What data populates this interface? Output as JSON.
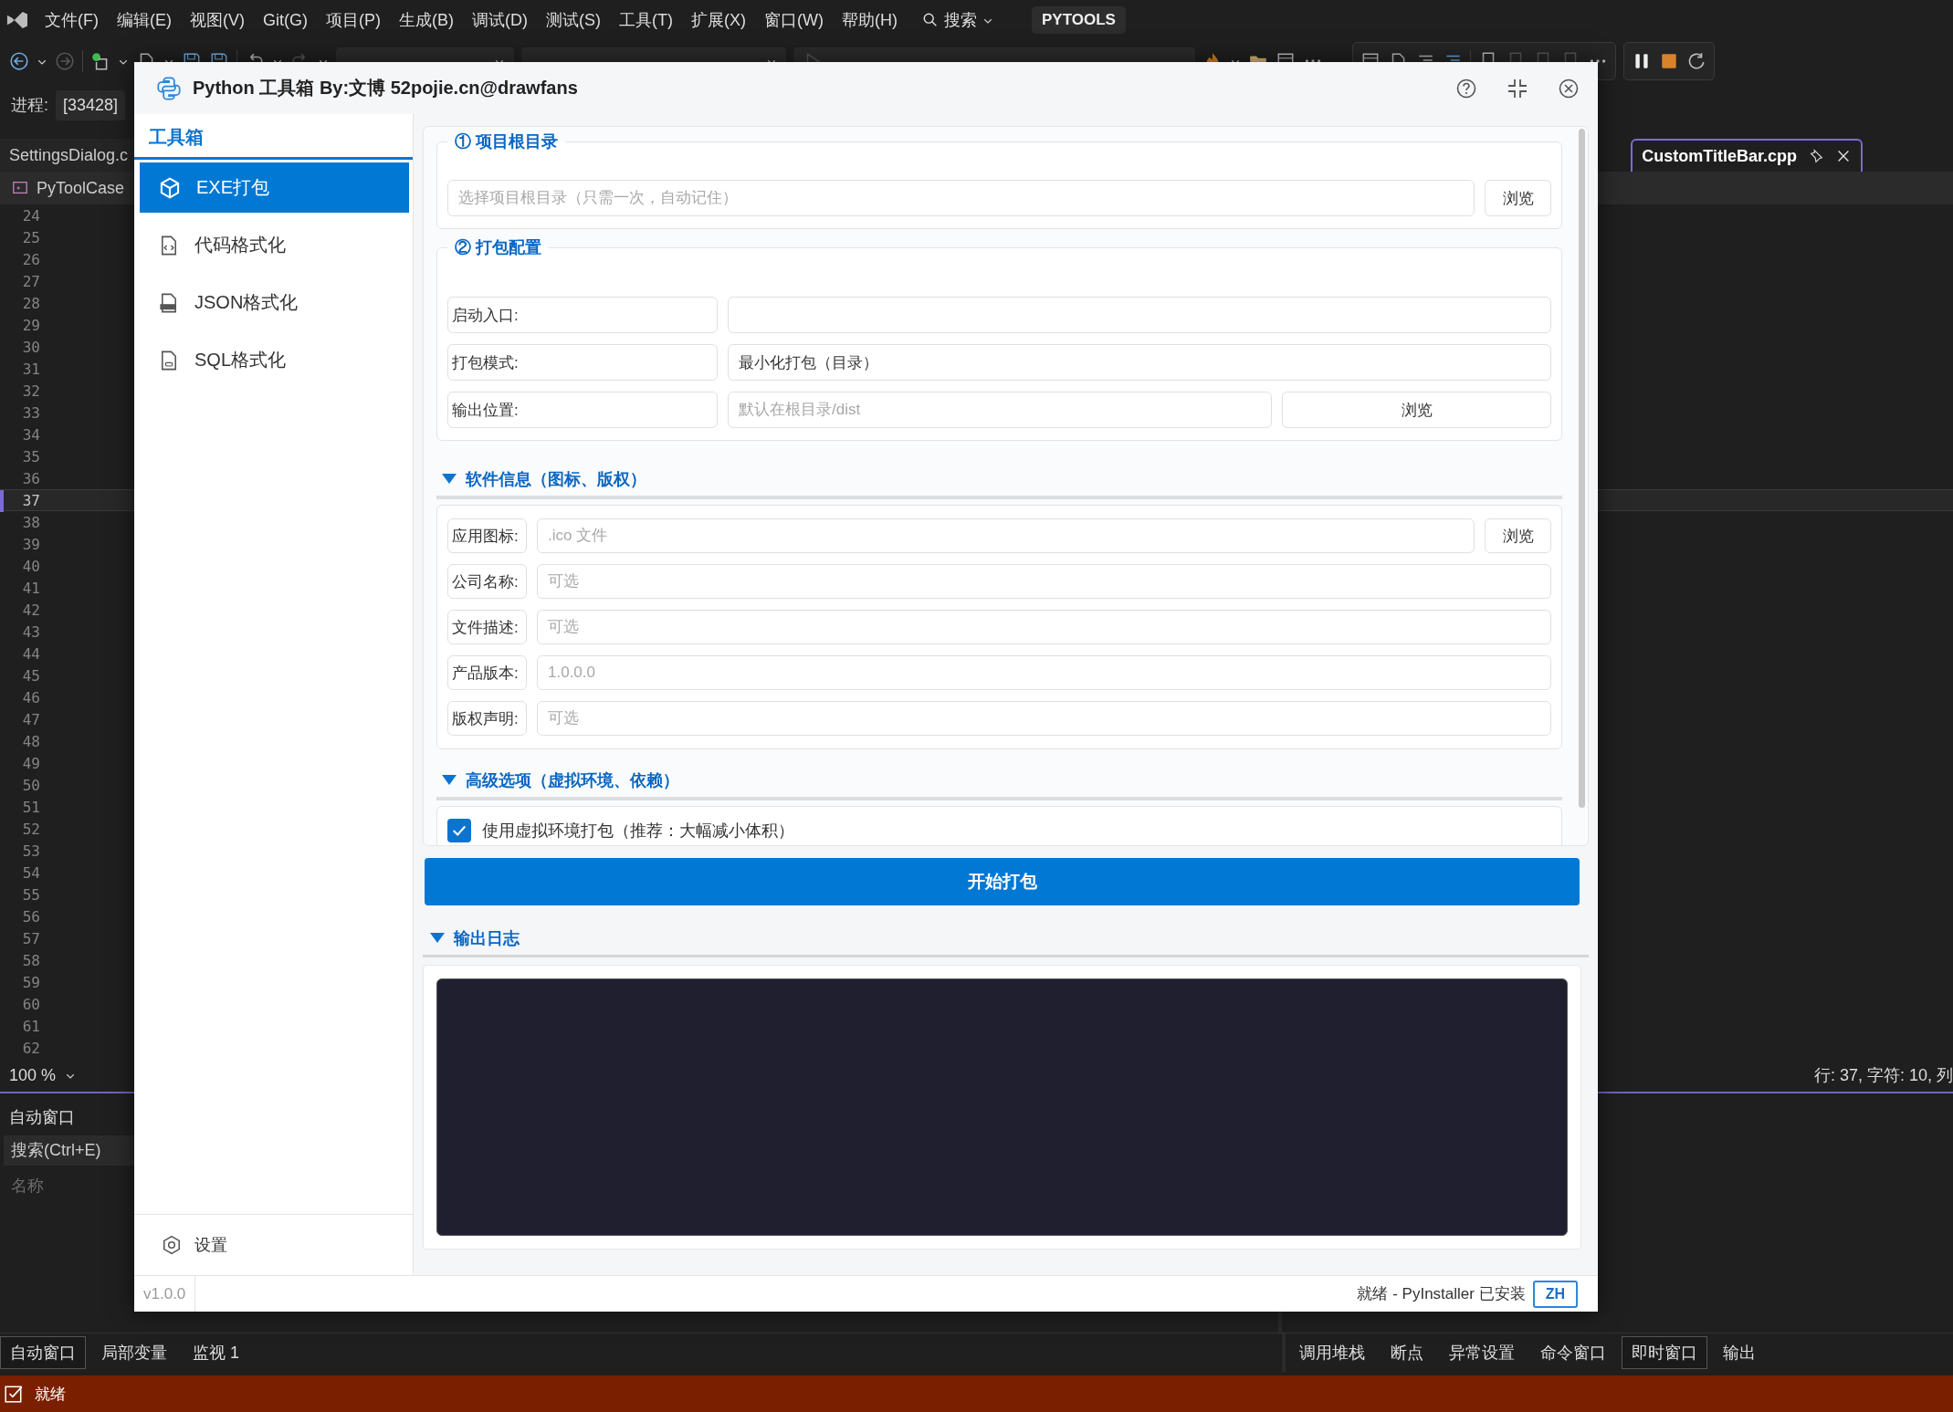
{
  "ide": {
    "menu": [
      "文件(F)",
      "编辑(E)",
      "视图(V)",
      "Git(G)",
      "项目(P)",
      "生成(B)",
      "调试(D)",
      "测试(S)",
      "工具(T)",
      "扩展(X)",
      "窗口(W)",
      "帮助(H)"
    ],
    "search": "搜索",
    "solution_badge": "PYTOOLS",
    "process": {
      "label": "进程:",
      "value": "[33428]"
    },
    "tabs": [
      {
        "label": "SettingsDialog.c",
        "selected": false
      },
      {
        "label": "CustomTitleBar.cpp",
        "selected": true
      }
    ],
    "project": "PyToolCase",
    "lines": [
      {
        "number": "24",
        "current": false
      },
      {
        "number": "25",
        "current": false
      },
      {
        "number": "26",
        "current": false
      },
      {
        "number": "27",
        "current": false
      },
      {
        "number": "28",
        "current": false
      },
      {
        "number": "29",
        "current": false
      },
      {
        "number": "30",
        "current": false
      },
      {
        "number": "31",
        "current": false
      },
      {
        "number": "32",
        "current": false
      },
      {
        "number": "33",
        "current": false
      },
      {
        "number": "34",
        "current": false
      },
      {
        "number": "35",
        "current": false
      },
      {
        "number": "36",
        "current": false
      },
      {
        "number": "37",
        "current": true
      },
      {
        "number": "38",
        "current": false
      },
      {
        "number": "39",
        "current": false
      },
      {
        "number": "40",
        "current": false
      },
      {
        "number": "41",
        "current": false
      },
      {
        "number": "42",
        "current": false
      },
      {
        "number": "43",
        "current": false
      },
      {
        "number": "44",
        "current": false
      },
      {
        "number": "45",
        "current": false
      },
      {
        "number": "46",
        "current": false
      },
      {
        "number": "47",
        "current": false
      },
      {
        "number": "48",
        "current": false
      },
      {
        "number": "49",
        "current": false
      },
      {
        "number": "50",
        "current": false
      },
      {
        "number": "51",
        "current": false
      },
      {
        "number": "52",
        "current": false
      },
      {
        "number": "53",
        "current": false
      },
      {
        "number": "54",
        "current": false
      },
      {
        "number": "55",
        "current": false
      },
      {
        "number": "56",
        "current": false
      },
      {
        "number": "57",
        "current": false
      },
      {
        "number": "58",
        "current": false
      },
      {
        "number": "59",
        "current": false
      },
      {
        "number": "60",
        "current": false
      },
      {
        "number": "61",
        "current": false
      },
      {
        "number": "62",
        "current": false
      }
    ],
    "zoom": "100 %",
    "cursor_position": "行: 37, 字符: 10, 列",
    "autos_panel": {
      "title": "自动窗口",
      "search_placeholder": "搜索(Ctrl+E)",
      "column": "名称"
    },
    "bottom_tabs_left": [
      {
        "label": "自动窗口",
        "selected": true
      },
      {
        "label": "局部变量",
        "selected": false
      },
      {
        "label": "监视 1",
        "selected": false
      }
    ],
    "bottom_tabs_right": [
      {
        "label": "调用堆栈",
        "selected": false
      },
      {
        "label": "断点",
        "selected": false
      },
      {
        "label": "异常设置",
        "selected": false
      },
      {
        "label": "命令窗口",
        "selected": false
      },
      {
        "label": "即时窗口",
        "selected": true
      },
      {
        "label": "输出",
        "selected": false
      }
    ],
    "status": "就绪"
  },
  "dialog": {
    "title": "Python 工具箱 By:文博 52pojie.cn@drawfans",
    "sidebar": {
      "heading": "工具箱",
      "items": [
        {
          "label": "EXE打包",
          "selected": true
        },
        {
          "label": "代码格式化",
          "selected": false
        },
        {
          "label": "JSON格式化",
          "selected": false
        },
        {
          "label": "SQL格式化",
          "selected": false
        }
      ],
      "settings": "设置"
    },
    "project_root": {
      "title": "① 项目根目录",
      "placeholder": "选择项目根目录（只需一次，自动记住）",
      "browse": "浏览"
    },
    "build_config": {
      "title": "② 打包配置",
      "rows": [
        {
          "label": "启动入口:"
        },
        {
          "label": "打包模式:",
          "value": "最小化打包（目录）"
        },
        {
          "label": "输出位置:",
          "placeholder": "默认在根目录/dist",
          "browse": "浏览"
        }
      ]
    },
    "software_info": {
      "title": "软件信息（图标、版权）",
      "expanded": true,
      "rows": [
        {
          "label": "应用图标:",
          "placeholder": ".ico 文件",
          "browse": "浏览"
        },
        {
          "label": "公司名称:",
          "placeholder": "可选"
        },
        {
          "label": "文件描述:",
          "placeholder": "可选"
        },
        {
          "label": "产品版本:",
          "placeholder": "1.0.0.0"
        },
        {
          "label": "版权声明:",
          "placeholder": "可选"
        }
      ]
    },
    "advanced": {
      "title": "高级选项（虚拟环境、依赖）",
      "expanded": true,
      "options": [
        {
          "label": "使用虚拟环境打包（推荐：大幅减小体积）",
          "checked": true
        }
      ]
    },
    "start_button": "开始打包",
    "log": {
      "title": "输出日志",
      "expanded": true
    },
    "status": {
      "version": "v1.0.0",
      "message": "就绪 - PyInstaller 已安装",
      "language": "ZH"
    }
  }
}
